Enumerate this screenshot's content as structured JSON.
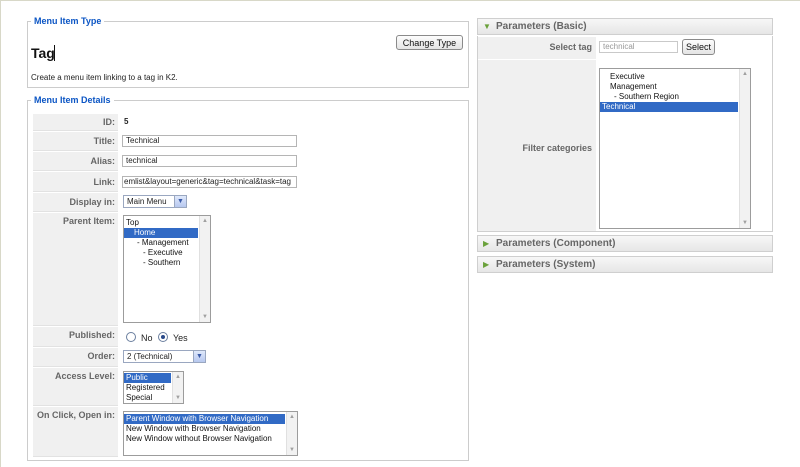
{
  "menu_item_type": {
    "legend": "Menu Item Type",
    "type_name": "Tag",
    "change_type_label": "Change Type",
    "description": "Create a menu item linking to a tag in K2."
  },
  "details": {
    "legend": "Menu Item Details",
    "id_label": "ID:",
    "id_value": "5",
    "title_label": "Title:",
    "title_value": "Technical",
    "alias_label": "Alias:",
    "alias_value": "technical",
    "link_label": "Link:",
    "link_value": "emlist&layout=generic&tag=technical&task=tag",
    "display_in_label": "Display in:",
    "display_in_value": "Main Menu",
    "parent_item_label": "Parent Item:",
    "parent_items": [
      "Top",
      "Home",
      "- Management",
      "- Executive",
      "- Southern"
    ],
    "parent_selected": "Home",
    "published_label": "Published:",
    "published_no": "No",
    "published_yes": "Yes",
    "published_value": "Yes",
    "order_label": "Order:",
    "order_value": "2 (Technical)",
    "access_level_label": "Access Level:",
    "access_levels": [
      "Public",
      "Registered",
      "Special"
    ],
    "access_selected": "Public",
    "on_click_label": "On Click, Open in:",
    "on_click_options": [
      "Parent Window with Browser Navigation",
      "New Window with Browser Navigation",
      "New Window without Browser Navigation"
    ],
    "on_click_selected": "Parent Window with Browser Navigation"
  },
  "params_basic": {
    "title": "Parameters (Basic)",
    "select_tag_label": "Select tag",
    "select_tag_value": "technical",
    "select_button": "Select",
    "filter_categories_label": "Filter categories",
    "categories": [
      "Executive",
      "Management",
      "- Southern Region",
      "Technical"
    ],
    "categories_selected": "Technical"
  },
  "params_component": {
    "title": "Parameters (Component)"
  },
  "params_system": {
    "title": "Parameters (System)"
  },
  "colors": {
    "legend_blue": "#0b55c4",
    "selection_blue": "#316ac5",
    "panel_arrow_green": "#6aa13a"
  }
}
